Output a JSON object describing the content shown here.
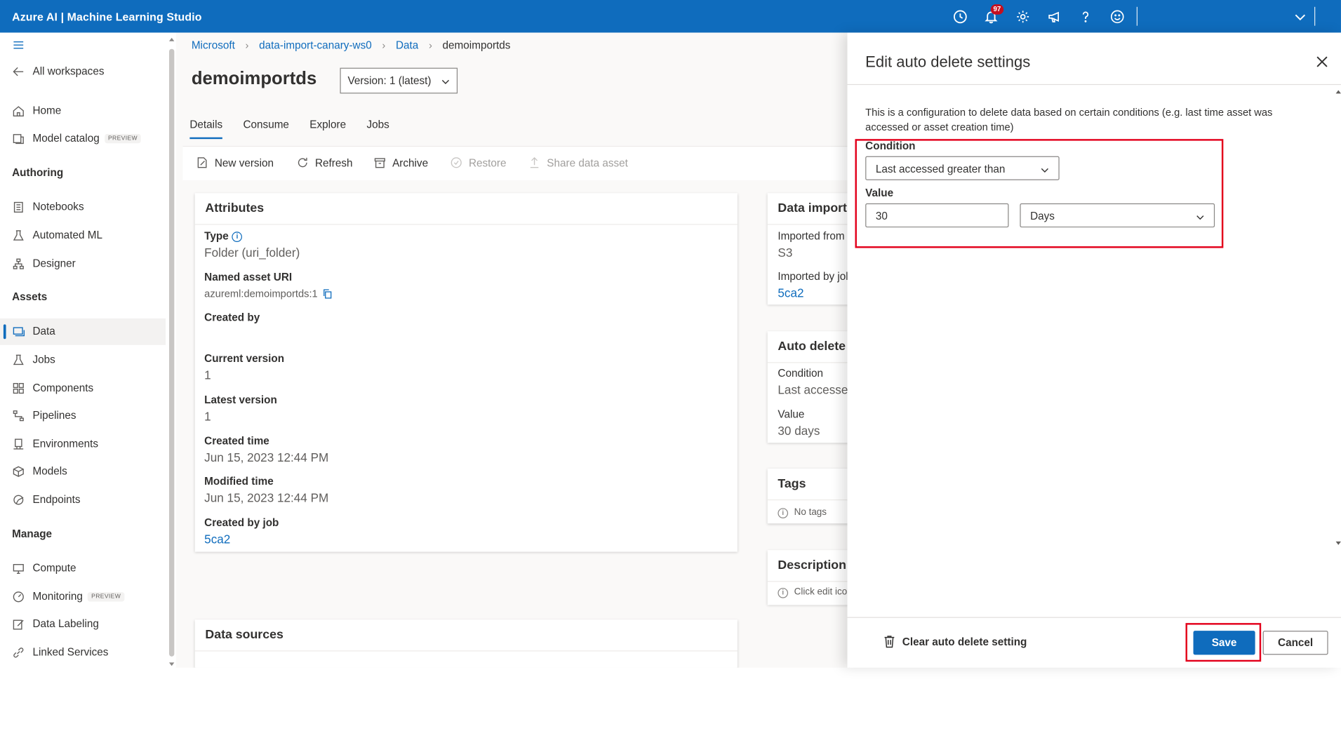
{
  "app": {
    "title": "Azure AI | Machine Learning Studio",
    "notification_count": "97",
    "accent": "#0f6cbd",
    "highlight": "#e3001b"
  },
  "topbar_icons": [
    "history-icon",
    "bell-icon",
    "gear-icon",
    "megaphone-icon",
    "help-icon",
    "smiley-icon",
    "chevron-down-icon"
  ],
  "nav": {
    "back": "All workspaces",
    "home": "Home",
    "model_catalog": "Model catalog",
    "preview": "PREVIEW",
    "authoring": "Authoring",
    "notebooks": "Notebooks",
    "automated_ml": "Automated ML",
    "designer": "Designer",
    "assets": "Assets",
    "data": "Data",
    "jobs": "Jobs",
    "components": "Components",
    "pipelines": "Pipelines",
    "environments": "Environments",
    "models": "Models",
    "endpoints": "Endpoints",
    "manage": "Manage",
    "compute": "Compute",
    "monitoring": "Monitoring",
    "data_labeling": "Data Labeling",
    "linked_services": "Linked Services"
  },
  "breadcrumb": [
    "Microsoft",
    "data-import-canary-ws0",
    "Data",
    "demoimportds"
  ],
  "page": {
    "title": "demoimportds",
    "version": "Version: 1 (latest)",
    "tabs": [
      "Details",
      "Consume",
      "Explore",
      "Jobs"
    ],
    "toolbar": {
      "new_version": "New version",
      "refresh": "Refresh",
      "archive": "Archive",
      "restore": "Restore",
      "share": "Share data asset"
    }
  },
  "attributes": {
    "title": "Attributes",
    "type_label": "Type",
    "type_value": "Folder (uri_folder)",
    "uri_label": "Named asset URI",
    "uri_value": "azureml:demoimportds:1",
    "created_by_label": "Created by",
    "created_by_value": "",
    "current_version_label": "Current version",
    "current_version_value": "1",
    "latest_version_label": "Latest version",
    "latest_version_value": "1",
    "created_time_label": "Created time",
    "created_time_value": "Jun 15, 2023 12:44 PM",
    "modified_time_label": "Modified time",
    "modified_time_value": "Jun 15, 2023 12:44 PM",
    "created_by_job_label": "Created by job",
    "created_by_job_value": "5ca2"
  },
  "data_sources": {
    "title": "Data sources"
  },
  "data_import": {
    "title": "Data import",
    "imported_from_label": "Imported from",
    "imported_from_value": "S3",
    "imported_by_label": "Imported by job",
    "imported_by_value": "5ca2"
  },
  "auto_delete": {
    "title": "Auto delete",
    "condition_label": "Condition",
    "condition_value": "Last accessed",
    "value_label": "Value",
    "value_value": "30 days"
  },
  "tags": {
    "title": "Tags",
    "empty": "No tags"
  },
  "description": {
    "title": "Description",
    "hint": "Click edit icon"
  },
  "panel": {
    "title": "Edit auto delete settings",
    "description": "This is a configuration to delete data based on certain conditions (e.g. last time asset was accessed or asset creation time)",
    "condition_label": "Condition",
    "condition_value": "Last accessed greater than",
    "value_label": "Value",
    "value_input": "30",
    "unit_value": "Days",
    "clear_label": "Clear auto delete setting",
    "save_label": "Save",
    "cancel_label": "Cancel"
  }
}
